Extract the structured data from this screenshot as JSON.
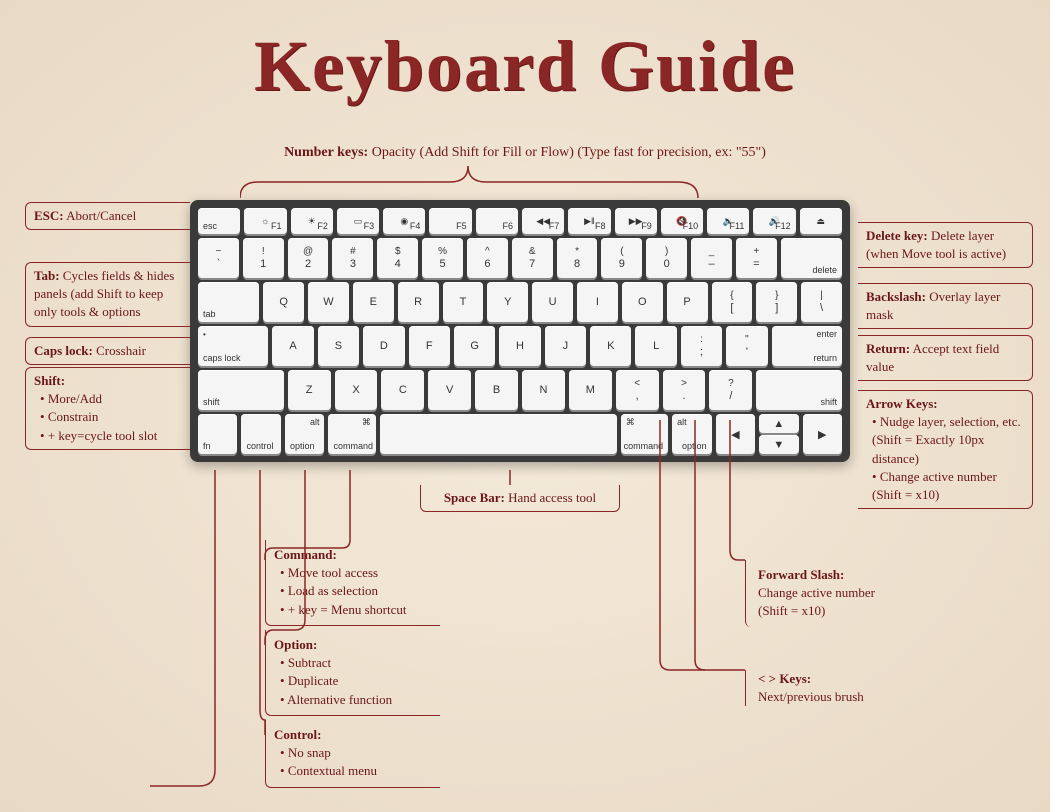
{
  "title": "Keyboard Guide",
  "numberKeys": {
    "label": "Number keys:",
    "desc": " Opacity (Add Shift for Fill or Flow) (Type fast for precision, ex: \"55\")"
  },
  "callouts": {
    "esc": {
      "label": "ESC:",
      "desc": " Abort/Cancel"
    },
    "tab": {
      "label": "Tab:",
      "desc": " Cycles fields & hides panels (add Shift to keep only tools & options"
    },
    "capslock": {
      "label": "Caps lock:",
      "desc": " Crosshair"
    },
    "shift": {
      "label": "Shift:",
      "items": [
        "More/Add",
        "Constrain",
        "+ key=cycle tool slot"
      ]
    },
    "delete": {
      "label": "Delete key:",
      "desc": " Delete layer (when Move tool is active)"
    },
    "backslash": {
      "label": "Backslash:",
      "desc": " Overlay layer mask"
    },
    "return": {
      "label": "Return:",
      "desc": " Accept text field value"
    },
    "arrow": {
      "label": "Arrow Keys:",
      "items": [
        "Nudge layer, selection, etc. (Shift = Exactly 10px distance)",
        "Change active number (Shift = x10)"
      ]
    },
    "space": {
      "label": "Space Bar:",
      "desc": " Hand access tool"
    },
    "command": {
      "label": "Command:",
      "items": [
        "Move tool access",
        "Load as selection",
        "+ key = Menu shortcut"
      ]
    },
    "option": {
      "label": "Option:",
      "items": [
        "Subtract",
        "Duplicate",
        "Alternative function"
      ]
    },
    "control": {
      "label": "Control:",
      "items": [
        "No snap",
        "Contextual menu"
      ]
    },
    "fwdslash": {
      "label": "Forward Slash:",
      "desc": "Change active number (Shift = x10)"
    },
    "brackets": {
      "label": "< > Keys:",
      "desc": "Next/previous brush"
    }
  },
  "keys": {
    "esc": "esc",
    "f1": "F1",
    "f2": "F2",
    "f3": "F3",
    "f4": "F4",
    "f5": "F5",
    "f6": "F6",
    "f7": "F7",
    "f8": "F8",
    "f9": "F9",
    "f10": "F10",
    "f11": "F11",
    "f12": "F12",
    "tilde_top": "~",
    "tilde_bot": "`",
    "n1t": "!",
    "n1b": "1",
    "n2t": "@",
    "n2b": "2",
    "n3t": "#",
    "n3b": "3",
    "n4t": "$",
    "n4b": "4",
    "n5t": "%",
    "n5b": "5",
    "n6t": "^",
    "n6b": "6",
    "n7t": "&",
    "n7b": "7",
    "n8t": "*",
    "n8b": "8",
    "n9t": "(",
    "n9b": "9",
    "n0t": ")",
    "n0b": "0",
    "dasht": "_",
    "dashb": "–",
    "plust": "+",
    "plusb": "=",
    "delete": "delete",
    "tab": "tab",
    "q": "Q",
    "w": "W",
    "e": "E",
    "r": "R",
    "t": "T",
    "y": "Y",
    "u": "U",
    "i": "I",
    "o": "O",
    "p": "P",
    "lbrackt": "{",
    "lbrackb": "[",
    "rbrackt": "}",
    "rbrackb": "]",
    "bslasht": "|",
    "bslashb": "\\",
    "caps": "caps lock",
    "a": "A",
    "s": "S",
    "d": "D",
    "f": "F",
    "g": "G",
    "h": "H",
    "j": "J",
    "k": "K",
    "l": "L",
    "semit": ":",
    "semib": ";",
    "quotet": "\"",
    "quoteb": "'",
    "enter": "enter",
    "return": "return",
    "shift": "shift",
    "z": "Z",
    "x": "X",
    "c": "C",
    "v": "V",
    "b": "B",
    "n": "N",
    "m": "M",
    "commat": "<",
    "commab": ",",
    "periodt": ">",
    "periodb": ".",
    "slasht": "?",
    "slashb": "/",
    "fn": "fn",
    "control": "control",
    "option": "option",
    "command": "command",
    "alt": "alt",
    "cmd": "⌘",
    "up": "▲",
    "down": "▼",
    "left": "◀",
    "right": "▶",
    "eject": "⏏"
  }
}
